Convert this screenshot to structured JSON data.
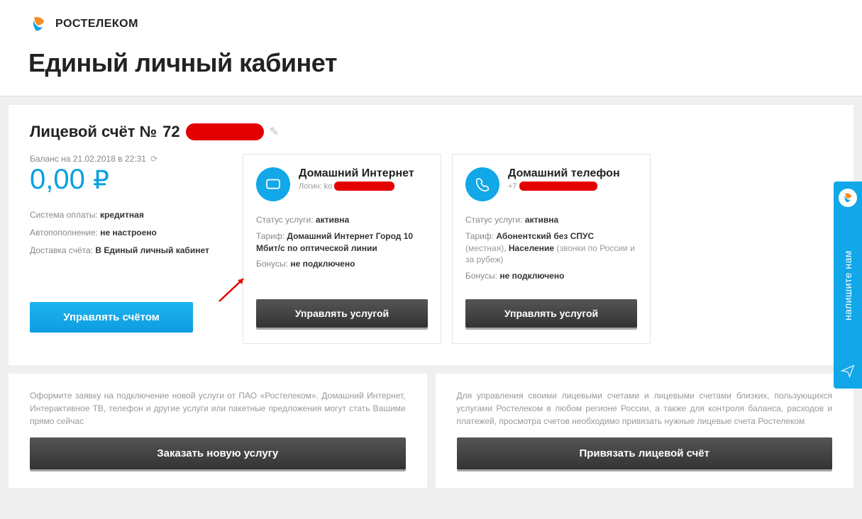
{
  "brand": "РОСТЕЛЕКОМ",
  "page_title": "Единый личный кабинет",
  "account": {
    "label": "Лицевой счёт №",
    "number_prefix": "72"
  },
  "balance": {
    "date": "Баланс на 21.02.2018 в 22:31",
    "amount": "0,00",
    "currency": "₽",
    "payment_system_label": "Система оплаты:",
    "payment_system_value": "кредитная",
    "autopay_label": "Автопополнение:",
    "autopay_value": "не настроено",
    "delivery_label": "Доставка счёта:",
    "delivery_value": "В Единый личный кабинет",
    "manage_btn": "Управлять счётом"
  },
  "service_internet": {
    "title": "Домашний Интернет",
    "sub_label": "Логин:",
    "sub_prefix": "ko",
    "status_label": "Статус услуги:",
    "status_value": "активна",
    "tariff_label": "Тариф:",
    "tariff_value": "Домашний Интернет Город 10 Мбит/с по оптической линии",
    "bonus_label": "Бонусы:",
    "bonus_value": "не подключено",
    "btn": "Управлять услугой"
  },
  "service_phone": {
    "title": "Домашний телефон",
    "sub_prefix": "+7",
    "status_label": "Статус услуги:",
    "status_value": "активна",
    "tariff_label": "Тариф:",
    "tariff_value_bold": "Абонентский без СПУС",
    "tariff_paren1": "(местная)",
    "tariff_value_bold2": "Население",
    "tariff_paren2": "(звонки по России и за рубеж)",
    "bonus_label": "Бонусы:",
    "bonus_value": "не подключено",
    "btn": "Управлять услугой"
  },
  "promo_left": {
    "text": "Оформите заявку на подключение новой услуги от ПАО «Ростелеком». Домашний Интернет, Интерактивное ТВ, телефон и другие услуги или пакетные предложения могут стать Вашими прямо сейчас",
    "btn": "Заказать новую услугу"
  },
  "promo_right": {
    "text": "Для управления своими лицевыми счетами и лицевыми счетами близких, пользующихся услугами Ростелеком в любом регионе России, а также для контроля баланса, расходов и платежей, просмотра счетов необходимо привязать нужные лицевые счета Ростелеком",
    "btn": "Привязать лицевой счёт"
  },
  "feedback_tab": "напишите нам"
}
